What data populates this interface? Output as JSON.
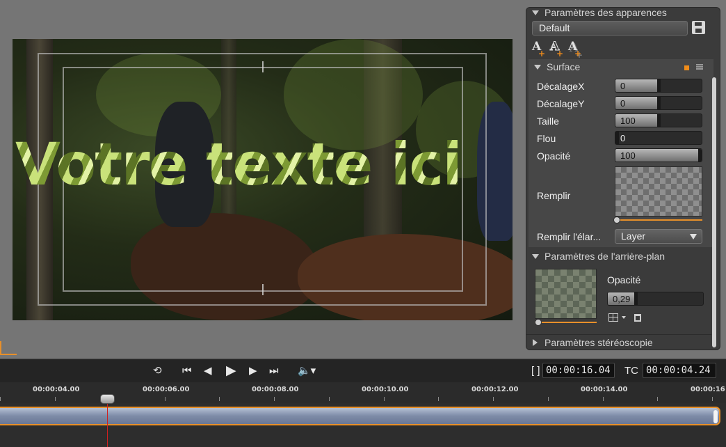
{
  "preview": {
    "title_text": "Votre texte ici"
  },
  "panel": {
    "appearance_header": "Paramètres des apparences",
    "preset_value": "Default",
    "surface_header": "Surface",
    "props": {
      "offset_x": {
        "label": "DécalageX",
        "value": "0",
        "level": 0.5
      },
      "offset_y": {
        "label": "DécalageY",
        "value": "0",
        "level": 0.5
      },
      "size": {
        "label": "Taille",
        "value": "100",
        "level": 0.5
      },
      "blur": {
        "label": "Flou",
        "value": "0",
        "level": 0
      },
      "opacity": {
        "label": "Opacité",
        "value": "100",
        "level": 1
      }
    },
    "fill_label": "Remplir",
    "fill_mode_label": "Remplir l'élar...",
    "fill_mode_value": "Layer",
    "background_header": "Paramètres de l'arrière-plan",
    "background_opacity_label": "Opacité",
    "background_opacity_value": "0,29",
    "background_opacity_level": 0.29,
    "stereo_header": "Paramètres stéréoscopie"
  },
  "transport": {
    "duration_label": "[ ]",
    "duration_value": "00:00:16.04",
    "tc_label": "TC",
    "tc_value": "00:00:04.24"
  },
  "timeline": {
    "ruler_labels": [
      "00:00:04.00",
      "00:00:06.00",
      "00:00:08.00",
      "00:00:10.00",
      "00:00:12.00",
      "00:00:14.00",
      "00:00:16"
    ]
  },
  "colors": {
    "accent": "#e8902a",
    "playhead": "#d02020",
    "clip": "#7d8ba7"
  }
}
